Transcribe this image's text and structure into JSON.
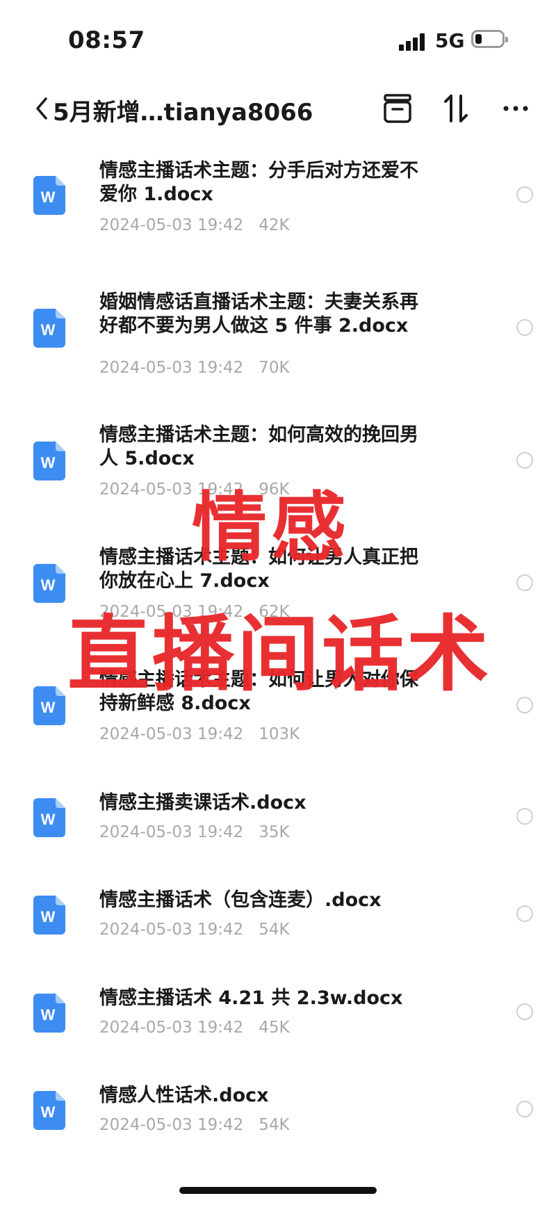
{
  "status_bar": {
    "time": "08:57",
    "network": "5G"
  },
  "nav": {
    "title": "5月新增…tianya8066",
    "icons": [
      "chevron-left-icon",
      "archive-icon",
      "sort-icon",
      "more-icon"
    ]
  },
  "files": [
    {
      "name_lines": [
        "情感主播话术主题：分手后对方还爱不",
        "爱你 1.docx"
      ],
      "date": "2024-05-03 19:42",
      "size": "42K",
      "icon": "word-doc-icon"
    },
    {
      "name_lines": [
        "婚姻情感话直播话术主题：夫妻关系再",
        "好都不要为男人做这 5 件事 2.docx"
      ],
      "date": "2024-05-03 19:42",
      "size": "70K",
      "icon": "word-doc-icon"
    },
    {
      "name_lines": [
        "情感主播话术主题：如何高效的挽回男",
        "人 5.docx"
      ],
      "date": "2024-05-03 19:42",
      "size": "96K",
      "icon": "word-doc-icon"
    },
    {
      "name_lines": [
        "情感主播话术主题：如何让男人真正把",
        "你放在心上 7.docx"
      ],
      "date": "2024-05-03 19:42",
      "size": "62K",
      "icon": "word-doc-icon"
    },
    {
      "name_lines": [
        "情感主播话术主题：如何让男人对你保",
        "持新鲜感 8.docx"
      ],
      "date": "2024-05-03 19:42",
      "size": "103K",
      "icon": "word-doc-icon"
    },
    {
      "name_lines": [
        "情感主播卖课话术.docx"
      ],
      "date": "2024-05-03 19:42",
      "size": "35K",
      "icon": "word-doc-icon"
    },
    {
      "name_lines": [
        "情感主播话术（包含连麦）.docx"
      ],
      "date": "2024-05-03 19:42",
      "size": "54K",
      "icon": "word-doc-icon"
    },
    {
      "name_lines": [
        "情感主播话术 4.21 共 2.3w.docx"
      ],
      "date": "2024-05-03 19:42",
      "size": "45K",
      "icon": "word-doc-icon"
    },
    {
      "name_lines": [
        "情感人性话术.docx"
      ],
      "date": "2024-05-03 19:42",
      "size": "54K",
      "icon": "word-doc-icon"
    }
  ],
  "overlay": {
    "line1": "情感",
    "line2": "直播间话术",
    "color": "#e8282b"
  },
  "colors": {
    "doc_icon": "#3d8cf2",
    "meta_text": "#a8a8a8"
  }
}
